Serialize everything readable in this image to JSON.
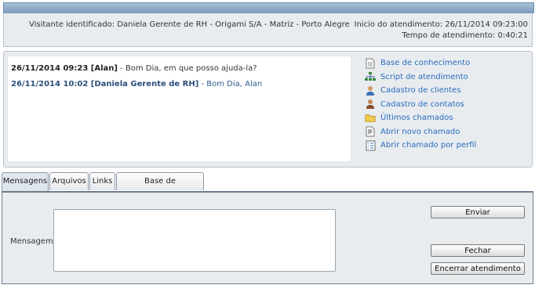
{
  "header": {
    "visitor": "Visitante identificado: Daniela Gerente de RH - Origami S/A - Matriz - Porto Alegre",
    "started": "Inicio do atendimento: 26/11/2014 09:23:00",
    "elapsed": "Tempo de atendimento: 0:40:21"
  },
  "chat": {
    "messages": [
      {
        "stamp": "26/11/2014 09:23 [Alan]",
        "text": " - Bom Dia, em que posso ajuda-la?"
      },
      {
        "stamp": "26/11/2014 10:02 [Daniela Gerente de RH]",
        "text": " - Bom Dia, Alan"
      }
    ]
  },
  "links": [
    {
      "label": "Base de conhecimento",
      "icon": "document-icon"
    },
    {
      "label": "Script de atendimento",
      "icon": "sitemap-icon"
    },
    {
      "label": "Cadastro de clientes",
      "icon": "user-icon"
    },
    {
      "label": "Cadastro de contatos",
      "icon": "contact-icon"
    },
    {
      "label": "Últimos chamados",
      "icon": "folder-icon"
    },
    {
      "label": "Abrir novo chamado",
      "icon": "new-document-icon"
    },
    {
      "label": "Abrir chamado por perfil",
      "icon": "form-list-icon"
    }
  ],
  "tabs": [
    {
      "label": "Mensagens",
      "active": true
    },
    {
      "label": "Arquivos",
      "active": false
    },
    {
      "label": "Links",
      "active": false
    },
    {
      "label": "Base de conhecimento",
      "active": false
    }
  ],
  "compose": {
    "label": "Mensagem:",
    "value": ""
  },
  "buttons": {
    "send": "Enviar",
    "close": "Fechar",
    "end": "Encerrar atendimento"
  },
  "colors": {
    "link": "#2a6cc0",
    "panel": "#e8ecef",
    "header_bar": "#7d9bbc"
  }
}
